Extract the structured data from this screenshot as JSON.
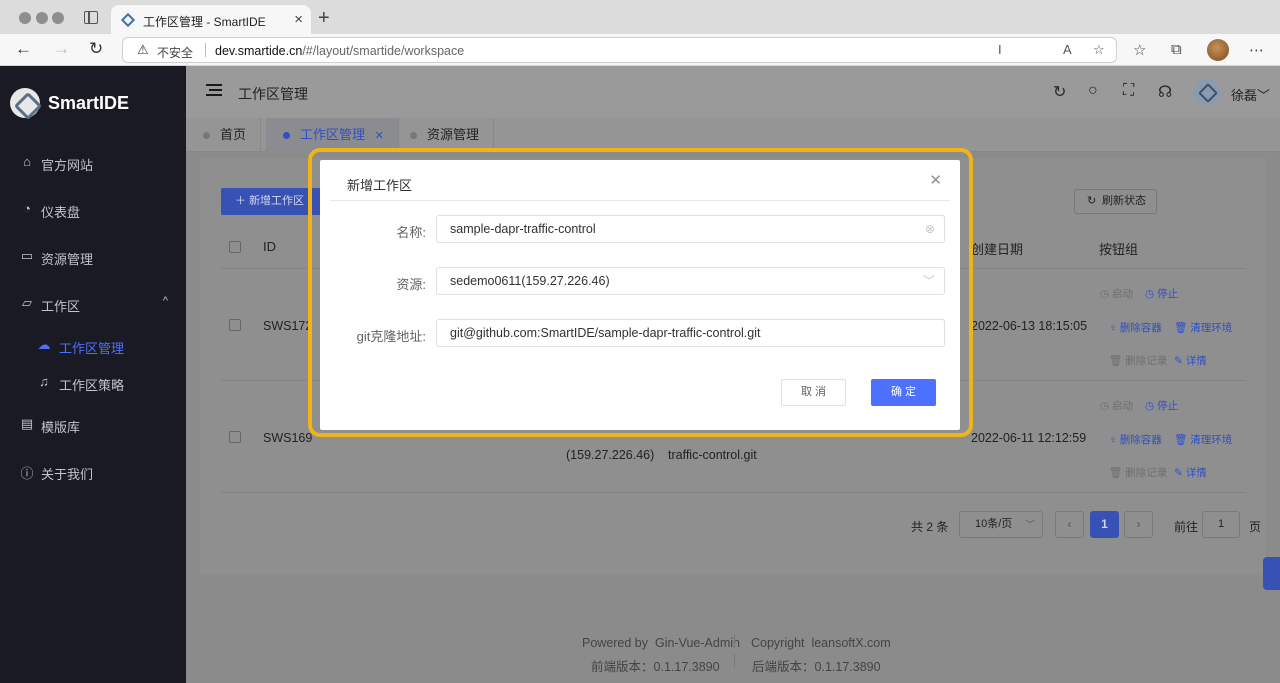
{
  "browser": {
    "tab_title": "工作区管理 - SmartIDE",
    "security_label": "不安全",
    "url_host": "dev.smartide.cn",
    "url_path": "/#/layout/smartide/workspace"
  },
  "sidebar": {
    "logo_text": "SmartIDE",
    "items": [
      {
        "label": "官方网站",
        "icon": "home-icon"
      },
      {
        "label": "仪表盘",
        "icon": "dashboard-icon"
      },
      {
        "label": "资源管理",
        "icon": "monitor-icon"
      },
      {
        "label": "工作区",
        "icon": "folder-icon"
      },
      {
        "label": "工作区管理",
        "icon": "cloud-icon"
      },
      {
        "label": "工作区策略",
        "icon": "bell-icon"
      },
      {
        "label": "模版库",
        "icon": "template-icon"
      },
      {
        "label": "关于我们",
        "icon": "info-icon"
      }
    ]
  },
  "header": {
    "title": "工作区管理",
    "username": "徐磊"
  },
  "tabs": [
    {
      "label": "首页"
    },
    {
      "label": "工作区管理"
    },
    {
      "label": "资源管理"
    }
  ],
  "toolbar": {
    "new_label": "新增工作区",
    "refresh_label": "刷新状态"
  },
  "table": {
    "columns": [
      "ID",
      "创建日期",
      "按钮组"
    ],
    "rows": [
      {
        "id": "SWS172",
        "created": "2022-06-13 18:15:05"
      },
      {
        "id": "SWS169",
        "created": "2022-06-11 12:12:59",
        "resource_tail": "(159.27.226.46)",
        "git_tail": "traffic-control.git"
      }
    ],
    "actions": {
      "start": "启动",
      "stop": "停止",
      "delete_container": "删除容器",
      "clean_env": "清理环境",
      "delete_record": "删除记录",
      "detail": "详情"
    }
  },
  "pagination": {
    "total": "共 2 条",
    "page_size": "10条/页",
    "current": "1",
    "goto_label": "前往",
    "goto_value": "1",
    "page_suffix": "页"
  },
  "footer": {
    "powered": "Powered by",
    "gin": "Gin-Vue-Admin",
    "copyright": "Copyright",
    "company": "leansoftX.com",
    "frontend": "前端版本：",
    "frontend_ver": "0.1.17.3890",
    "backend": "后端版本：",
    "backend_ver": "0.1.17.3890"
  },
  "dialog": {
    "title": "新增工作区",
    "name_label": "名称:",
    "name_value": "sample-dapr-traffic-control",
    "resource_label": "资源:",
    "resource_value": "sedemo0611(159.27.226.46)",
    "git_label": "git克隆地址:",
    "git_value": "git@github.com:SmartIDE/sample-dapr-traffic-control.git",
    "cancel_label": "取 消",
    "confirm_label": "确 定"
  },
  "colors": {
    "accent": "#4d70ff",
    "sidebar_bg": "#191a23",
    "highlight_ring": "#f0b419"
  }
}
